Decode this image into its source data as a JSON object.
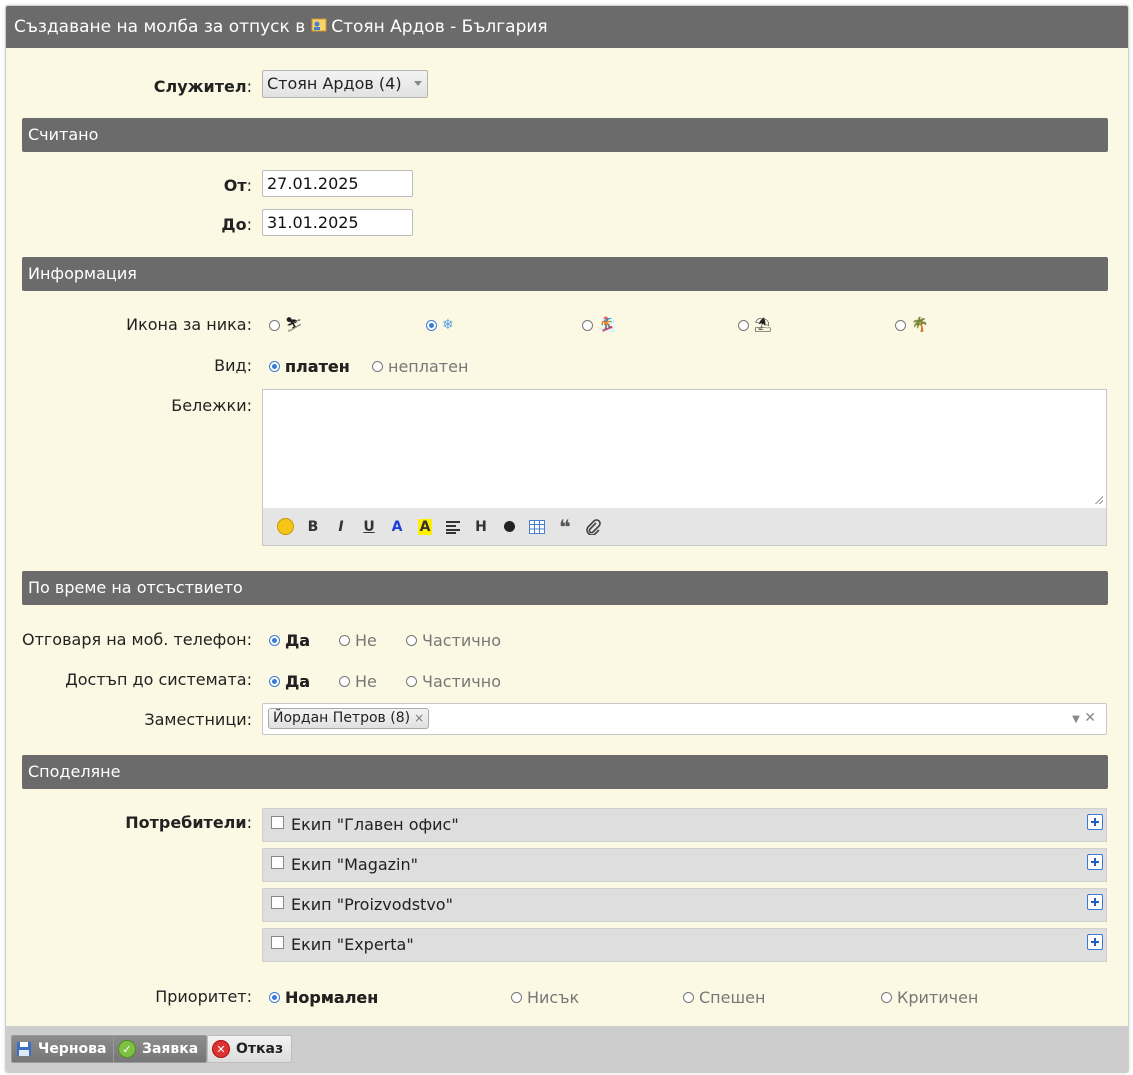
{
  "window": {
    "title": "Създаване на молба за отпуск в",
    "title_user": "Стоян Ардов - България"
  },
  "employee": {
    "label": "Служител",
    "value": "Стоян Ардов (4)"
  },
  "counted": {
    "section": "Считано",
    "from_label": "От",
    "from_value": "27.01.2025",
    "to_label": "До",
    "to_value": "31.01.2025"
  },
  "info": {
    "section": "Информация",
    "icon_label": "Икона за ника",
    "icons": [
      "ski-icon",
      "snowflake-icon",
      "snowboard-icon",
      "beach-icon",
      "palm-icon"
    ],
    "selected_icon": 1,
    "type_label": "Вид",
    "type_options": [
      "платен",
      "неплатен"
    ],
    "type_selected": 0,
    "notes_label": "Бележки",
    "notes_value": ""
  },
  "absence": {
    "section": "По време на отсъствието",
    "phone_label": "Отговаря на моб. телефон",
    "phone_options": [
      "Да",
      "Не",
      "Частично"
    ],
    "phone_selected": 0,
    "system_label": "Достъп до системата",
    "system_options": [
      "Да",
      "Не",
      "Частично"
    ],
    "system_selected": 0,
    "deputies_label": "Заместници",
    "deputies": [
      "Йордан Петров (8)"
    ]
  },
  "sharing": {
    "section": "Споделяне",
    "users_label": "Потребители",
    "teams": [
      "Екип \"Главен офис\"",
      "Екип \"Magazin\"",
      "Екип \"Proizvodstvo\"",
      "Екип \"Experta\""
    ],
    "priority_label": "Приоритет",
    "priority_options": [
      "Нормален",
      "Нисък",
      "Спешен",
      "Критичен"
    ],
    "priority_selected": 0
  },
  "footer": {
    "draft": "Чернова",
    "submit": "Заявка",
    "cancel": "Отказ"
  },
  "colors": {
    "header": "#6b6b6b",
    "background": "#fbf9e3",
    "accent": "#3a7bd5"
  }
}
